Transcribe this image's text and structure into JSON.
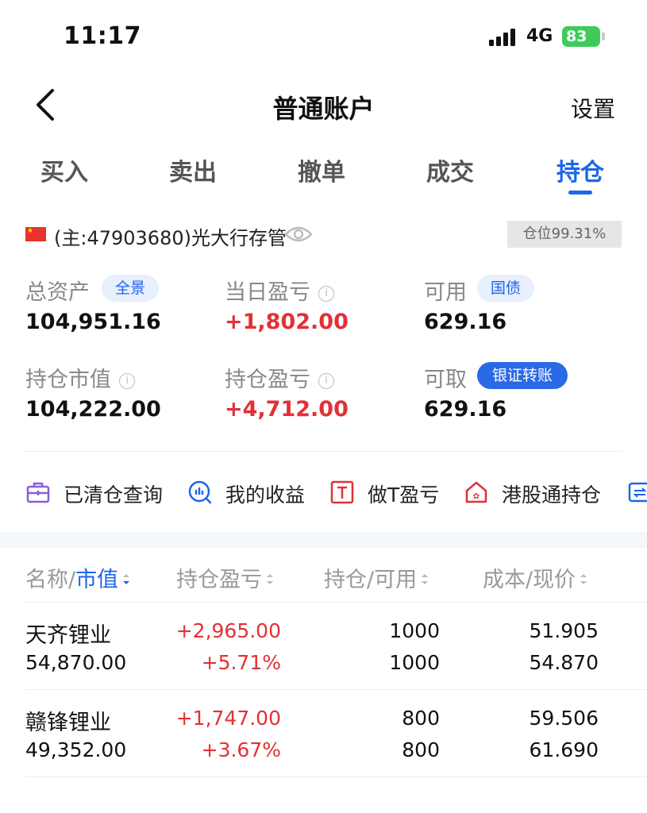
{
  "status": {
    "time": "11:17",
    "network": "4G",
    "battery": "83"
  },
  "nav": {
    "title": "普通账户",
    "settings": "设置"
  },
  "tabs": [
    "买入",
    "卖出",
    "撤单",
    "成交",
    "持仓"
  ],
  "account": {
    "label": "(主:47903680)光大行存管",
    "position_badge": "仓位99.31%"
  },
  "stats": {
    "total_assets": {
      "label": "总资产",
      "value": "104,951.16",
      "pill": "全景"
    },
    "daily_pnl": {
      "label": "当日盈亏",
      "value": "+1,802.00"
    },
    "available": {
      "label": "可用",
      "value": "629.16",
      "pill": "国债"
    },
    "market_value": {
      "label": "持仓市值",
      "value": "104,222.00"
    },
    "position_pnl": {
      "label": "持仓盈亏",
      "value": "+4,712.00"
    },
    "withdrawable": {
      "label": "可取",
      "value": "629.16",
      "pill": "银证转账"
    }
  },
  "quick_actions": [
    "已清仓查询",
    "我的收益",
    "做T盈亏",
    "港股通持仓"
  ],
  "table": {
    "headers": {
      "name_prefix": "名称/",
      "name_sort": "市值",
      "pnl": "持仓盈亏",
      "holding": "持仓/可用",
      "cost": "成本/现价"
    },
    "rows": [
      {
        "name": "天齐锂业",
        "market_value": "54,870.00",
        "pnl": "+2,965.00",
        "pnl_pct": "+5.71%",
        "holding": "1000",
        "available": "1000",
        "cost": "51.905",
        "price": "54.870"
      },
      {
        "name": "赣锋锂业",
        "market_value": "49,352.00",
        "pnl": "+1,747.00",
        "pnl_pct": "+3.67%",
        "holding": "800",
        "available": "800",
        "cost": "59.506",
        "price": "61.690"
      }
    ]
  },
  "colors": {
    "accent": "#1d66e8",
    "profit": "#e33036",
    "battery": "#3fcb5b"
  }
}
